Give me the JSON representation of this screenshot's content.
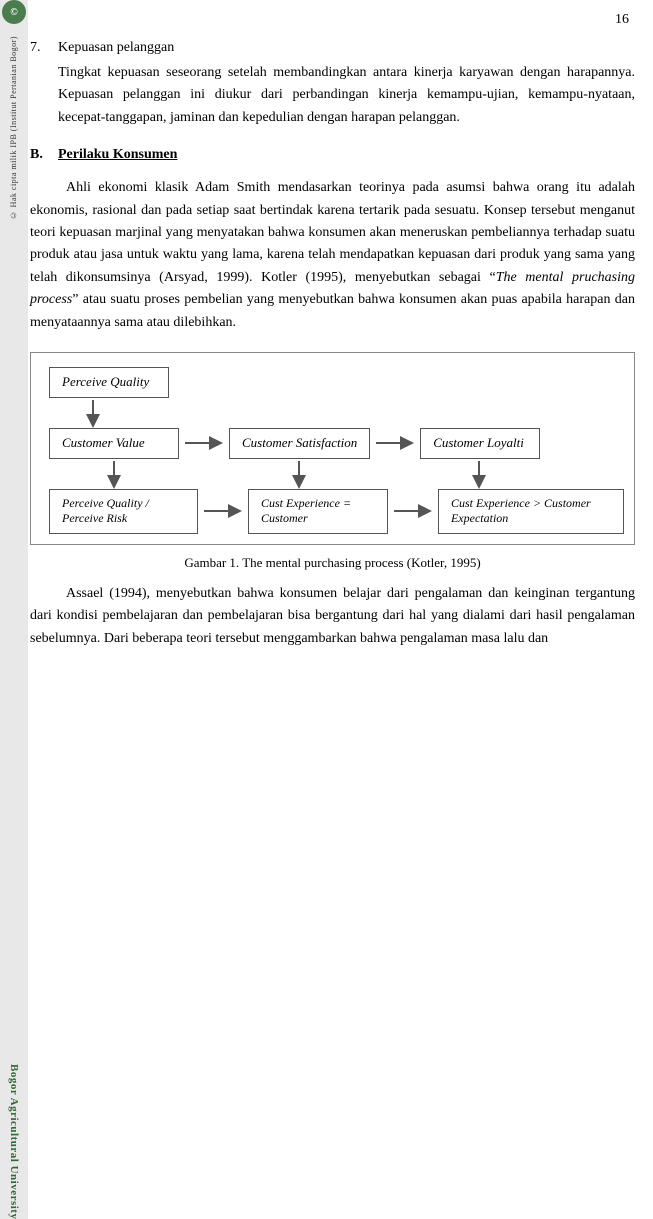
{
  "page": {
    "number": "16",
    "sidebar": {
      "logo_text": "C",
      "watermark_top": "© Hak cipta milik IPB (Institut Pertanian Bogor)",
      "watermark_bottom": "Bogor Agricultural University"
    },
    "section7": {
      "number": "7.",
      "title": "Kepuasan pelanggan",
      "body": "Tingkat kepuasan seseorang setelah membandingkan antara kinerja karyawan dengan harapannya.  Kepuasan pelanggan ini diukur dari perbandingan kinerja kemampu-ujian,  kemampu-nyataan,  kecepat-tanggapan,  jaminan  dan kepedulian dengan harapan pelanggan."
    },
    "sectionB": {
      "letter": "B.",
      "title": "Perilaku Konsumen",
      "paragraphs": [
        "Ahli  ekonomi  klasik  Adam  Smith  mendasarkan  teorinya  pada  asumsi bahwa orang itu adalah ekonomis, rasional dan pada setiap saat bertindak karena tertarik pada sesuatu. Konsep tersebut menganut teori kepuasan marjinal yang menyatakan bahwa konsumen akan meneruskan pembeliannya terhadap suatu produk atau jasa untuk waktu yang lama, karena telah mendapatkan kepuasan dari produk yang sama yang telah dikonsumsinya (Arsyad, 1999). Kotler (1995), menyebutkan sebagai “The mental pruchasing process” atau suatu proses pembelian yang menyebutkan bahwa konsumen akan puas apabila harapan dan menyataannya sama atau dilebihkan.",
        "Assael (1994), menyebutkan bahwa konsumen belajar dari pengalaman dan keinginan tergantung dari kondisi pembelajaran dan pembelajaran bisa bergantung dari hal yang dialami dari hasil pengalaman sebelumnya. Dari beberapa teori tersebut menggambarkan bahwa pengalaman masa lalu dan"
      ]
    },
    "diagram": {
      "box1": "Perceive Quality",
      "box2": "Customer Value",
      "box3": "Customer Satisfaction",
      "box4": "Customer Loyalti",
      "box5": "Perceive Quality / Perceive Risk",
      "box6": "Cust Experience = Customer",
      "box7": "Cust Experience > Customer Expectation"
    },
    "figure_caption": "Gambar 1.  The mental purchasing process  (Kotler, 1995)"
  }
}
